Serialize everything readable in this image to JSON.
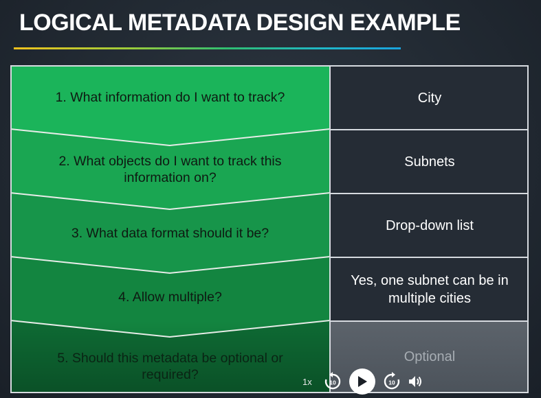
{
  "header": {
    "title": "LOGICAL METADATA DESIGN EXAMPLE"
  },
  "questions": [
    "1. What information do I want to track?",
    "2. What objects do I want to track this information on?",
    "3. What data format should it be?",
    "4. Allow multiple?",
    "5. Should this metadata be optional or required?"
  ],
  "answers": [
    "City",
    "Subnets",
    "Drop-down list",
    "Yes, one subnet can be in multiple cities",
    "Optional"
  ],
  "player": {
    "speed_label": "1x",
    "rewind_seconds": "10",
    "forward_seconds": "10"
  },
  "colors": {
    "row_greens": [
      "#1bb45a",
      "#1aa652",
      "#17954a",
      "#138540",
      "#0e6b34"
    ],
    "answer_bg": "#252c35",
    "answer_dim_bg": "#555c64"
  }
}
